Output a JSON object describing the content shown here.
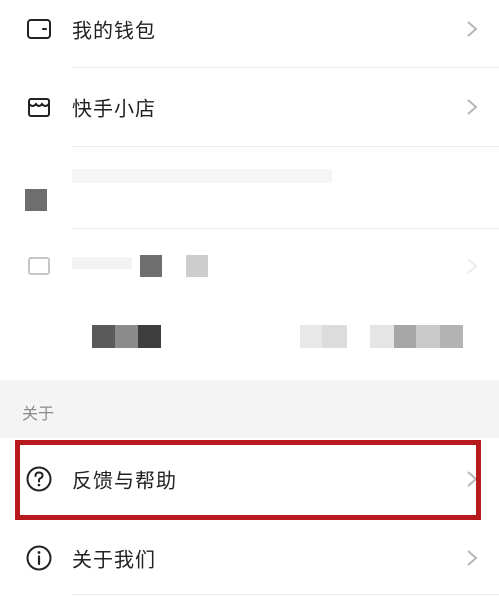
{
  "menu": {
    "items": [
      {
        "label": "我的钱包",
        "icon": "wallet-icon"
      },
      {
        "label": "快手小店",
        "icon": "store-icon"
      }
    ],
    "about_section_title": "关于",
    "about_items": [
      {
        "label": "反馈与帮助",
        "icon": "question-circle-icon"
      },
      {
        "label": "关于我们",
        "icon": "info-circle-icon"
      }
    ]
  },
  "colors": {
    "highlight_border": "#b8191c",
    "section_bg": "#f4f4f4"
  }
}
